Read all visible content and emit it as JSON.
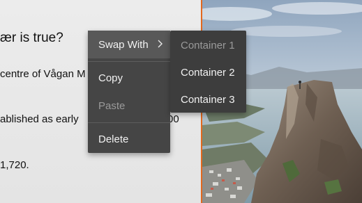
{
  "document": {
    "question": "ær is true?",
    "line1": "centre of Vågan M",
    "line2": "ablished as early",
    "line2_tail": "00",
    "line3": "1,720."
  },
  "context_menu": {
    "swap_with_label": "Swap With",
    "copy_label": "Copy",
    "paste_label": "Paste",
    "delete_label": "Delete",
    "submenu": [
      "Container 1",
      "Container 2",
      "Container 3"
    ]
  },
  "colors": {
    "divider": "#e2681e",
    "menu_bg": "#454545",
    "submenu_bg": "#3d3d3d",
    "menu_text": "#f2f2f2",
    "disabled_text": "#9a9a9a"
  },
  "icons": {
    "submenu_arrow": "chevron-right-icon"
  }
}
